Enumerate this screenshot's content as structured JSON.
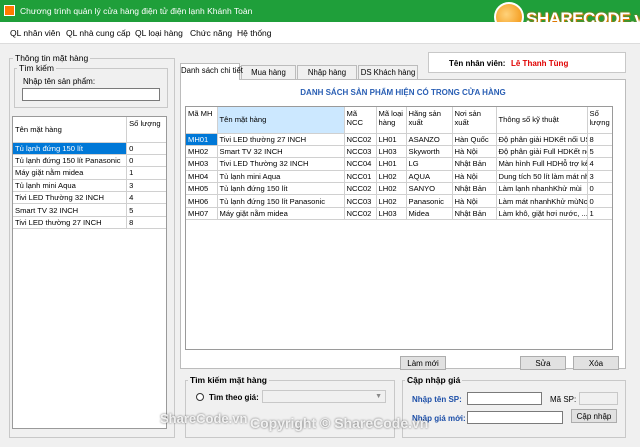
{
  "window": {
    "title": "Chương trình quản lý cửa hàng điện tử điện lạnh Khánh Toàn"
  },
  "brand": {
    "logo_text": "SHARECODE.vn",
    "footer_left": "ShareCode.vn",
    "footer_center": "Copyright © ShareCode.vn",
    "accent": "#1f9f3a"
  },
  "menu": {
    "items": [
      "QL nhân viên",
      "QL nhà cung cấp",
      "QL loại hàng",
      "Chức năng",
      "Hệ thống"
    ]
  },
  "left_panel": {
    "group_title": "Thông tin mặt hàng",
    "search_group": "Tìm kiếm",
    "search_label": "Nhập tên sản phẩm:",
    "search_value": "",
    "columns": [
      "Tên mặt hàng",
      "Số lượng"
    ],
    "rows": [
      [
        "Tủ lạnh đứng 150 lít",
        "0"
      ],
      [
        "Tủ lạnh đứng 150 lít Panasonic",
        "0"
      ],
      [
        "Máy giặt nằm midea",
        "1"
      ],
      [
        "Tủ lạnh mini Aqua",
        "3"
      ],
      [
        "Tivi LED Thường 32 INCH",
        "4"
      ],
      [
        "Smart TV 32 INCH",
        "5"
      ],
      [
        "Tivi LED thường 27 INCH",
        "8"
      ]
    ]
  },
  "tabs": [
    "Danh sách chi tiết",
    "Mua hàng",
    "Nhập hàng",
    "DS Khách hàng"
  ],
  "staff": {
    "label": "Tên nhân viên:",
    "name": "Lê Thanh Tùng",
    "name_color": "#e00000"
  },
  "detail": {
    "heading": "DANH SÁCH SẢN PHẨM HIỆN CÓ TRONG CỬA HÀNG",
    "heading_color": "#2a5fb4",
    "columns": [
      "Mã MH",
      "Tên mặt hàng",
      "Mã NCC",
      "Mã loại hàng",
      "Hãng sản xuất",
      "Nơi sản xuất",
      "Thông số kỹ thuật",
      "Số lượng"
    ],
    "rows": [
      [
        "MH01",
        "Tivi LED thường 27 INCH",
        "NCC02",
        "LH01",
        "ASANZO",
        "Hàn Quốc",
        "Độ phân giải HDKết nối US...",
        "8"
      ],
      [
        "MH02",
        "Smart TV 32 INCH",
        "NCC03",
        "LH03",
        "Skyworth",
        "Hà Nội",
        "Độ phân giải Full HDKết nối...",
        "5"
      ],
      [
        "MH03",
        "Tivi LED Thường 32 INCH",
        "NCC04",
        "LH01",
        "LG",
        "Nhật Bản",
        "Màn hình Full HDHỗ trợ kết ...",
        "4"
      ],
      [
        "MH04",
        "Tủ lạnh mini Aqua",
        "NCC01",
        "LH02",
        "AQUA",
        "Hà Nội",
        "Dung tích 50 lít làm mát nh...",
        "3"
      ],
      [
        "MH05",
        "Tủ lạnh đứng 150 lít",
        "NCC02",
        "LH02",
        "SANYO",
        "Nhật Bản",
        "Làm lạnh nhanhKhử mùi",
        "0"
      ],
      [
        "MH06",
        "Tủ lạnh đứng 150 lít Panasonic",
        "NCC03",
        "LH02",
        "Panasonic",
        "Hà Nội",
        "Làm mát nhanhKhử mùNo i...",
        "0"
      ],
      [
        "MH07",
        "Máy giặt nằm midea",
        "NCC02",
        "LH03",
        "Midea",
        "Nhật Bản",
        "Làm khô, giặt hơi nước, ...",
        "1"
      ]
    ],
    "btn_refresh": "Làm mới",
    "btn_edit": "Sửa",
    "btn_delete": "Xóa"
  },
  "search_goods": {
    "title": "Tìm kiếm mặt hàng",
    "by_price": "Tìm theo giá:"
  },
  "price_update": {
    "title": "Cập nhập giá",
    "name_label": "Nhập tên SP:",
    "code_label": "Mã SP:",
    "price_label": "Nhập giá mới:",
    "btn_update": "Cập nhập",
    "label_color": "#1d4fa8"
  }
}
